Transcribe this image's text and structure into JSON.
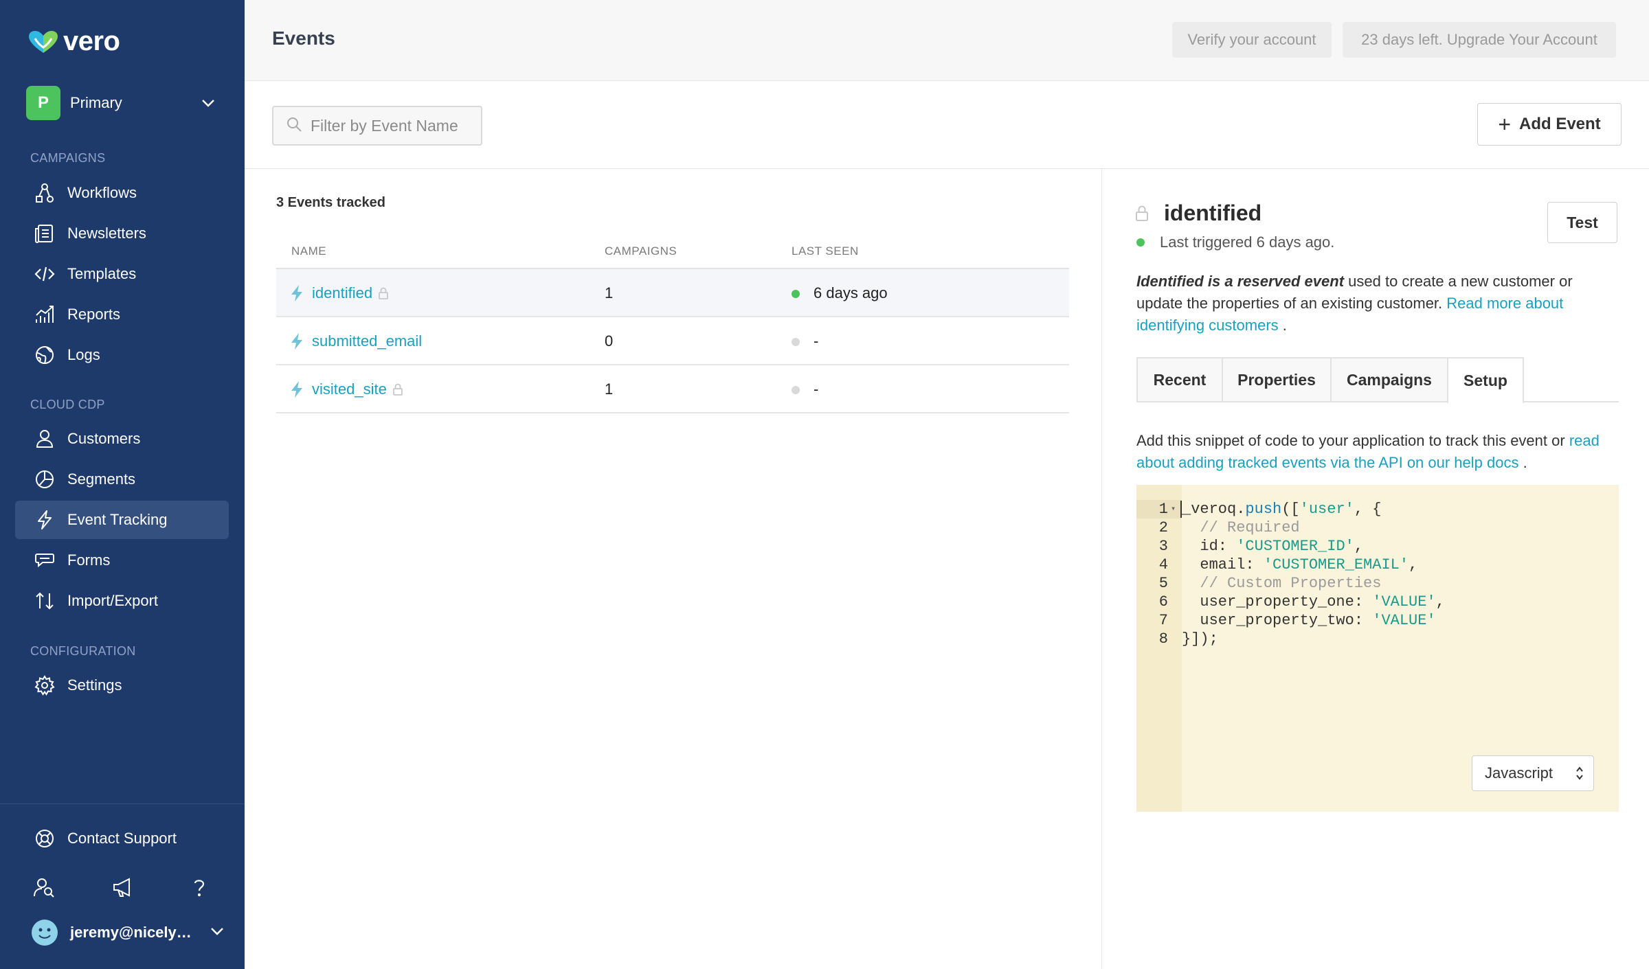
{
  "app": {
    "brand": "vero",
    "accent": "#1aa0bf",
    "sidebar_bg": "#1e3a6b"
  },
  "sidebar": {
    "workspace": {
      "initial": "P",
      "name": "Primary"
    },
    "sections": [
      {
        "label": "CAMPAIGNS",
        "items": [
          {
            "label": "Workflows",
            "icon": "workflows-icon"
          },
          {
            "label": "Newsletters",
            "icon": "newsletters-icon"
          },
          {
            "label": "Templates",
            "icon": "code-icon"
          },
          {
            "label": "Reports",
            "icon": "reports-icon"
          },
          {
            "label": "Logs",
            "icon": "logs-icon"
          }
        ]
      },
      {
        "label": "CLOUD CDP",
        "items": [
          {
            "label": "Customers",
            "icon": "user-icon"
          },
          {
            "label": "Segments",
            "icon": "pie-icon"
          },
          {
            "label": "Event Tracking",
            "icon": "bolt-icon",
            "active": true
          },
          {
            "label": "Forms",
            "icon": "forms-icon"
          },
          {
            "label": "Import/Export",
            "icon": "import-export-icon"
          }
        ]
      },
      {
        "label": "CONFIGURATION",
        "items": [
          {
            "label": "Settings",
            "icon": "gear-icon"
          }
        ]
      }
    ],
    "contact_support": "Contact Support",
    "user": {
      "email": "jeremy@nicely…"
    }
  },
  "header": {
    "title": "Events",
    "verify_label": "Verify your account",
    "upgrade_label": "23 days left. Upgrade Your Account"
  },
  "toolbar": {
    "search_placeholder": "Filter by Event Name",
    "add_event_label": "Add Event"
  },
  "events": {
    "count_label": "3 Events tracked",
    "columns": [
      "NAME",
      "CAMPAIGNS",
      "LAST SEEN"
    ],
    "rows": [
      {
        "name": "identified",
        "locked": true,
        "campaigns": "1",
        "last_seen": "6 days ago",
        "status": "active"
      },
      {
        "name": "submitted_email",
        "locked": false,
        "campaigns": "0",
        "last_seen": "-",
        "status": "inactive"
      },
      {
        "name": "visited_site",
        "locked": true,
        "campaigns": "1",
        "last_seen": "-",
        "status": "inactive"
      }
    ]
  },
  "detail": {
    "title": "identified",
    "test_label": "Test",
    "last_triggered": "Last triggered 6 days ago.",
    "desc_em": "Identified is a reserved event",
    "desc_text": " used to create a new customer or update the properties of an existing customer. ",
    "desc_link": "Read more about identifying customers",
    "desc_end": " .",
    "tabs": [
      "Recent",
      "Properties",
      "Campaigns",
      "Setup"
    ],
    "active_tab": "Setup",
    "snippet_text": "Add this snippet of code to your application to track this event or ",
    "snippet_link": "read about adding tracked events via the API on our help docs",
    "snippet_end": " .",
    "language": "Javascript"
  }
}
